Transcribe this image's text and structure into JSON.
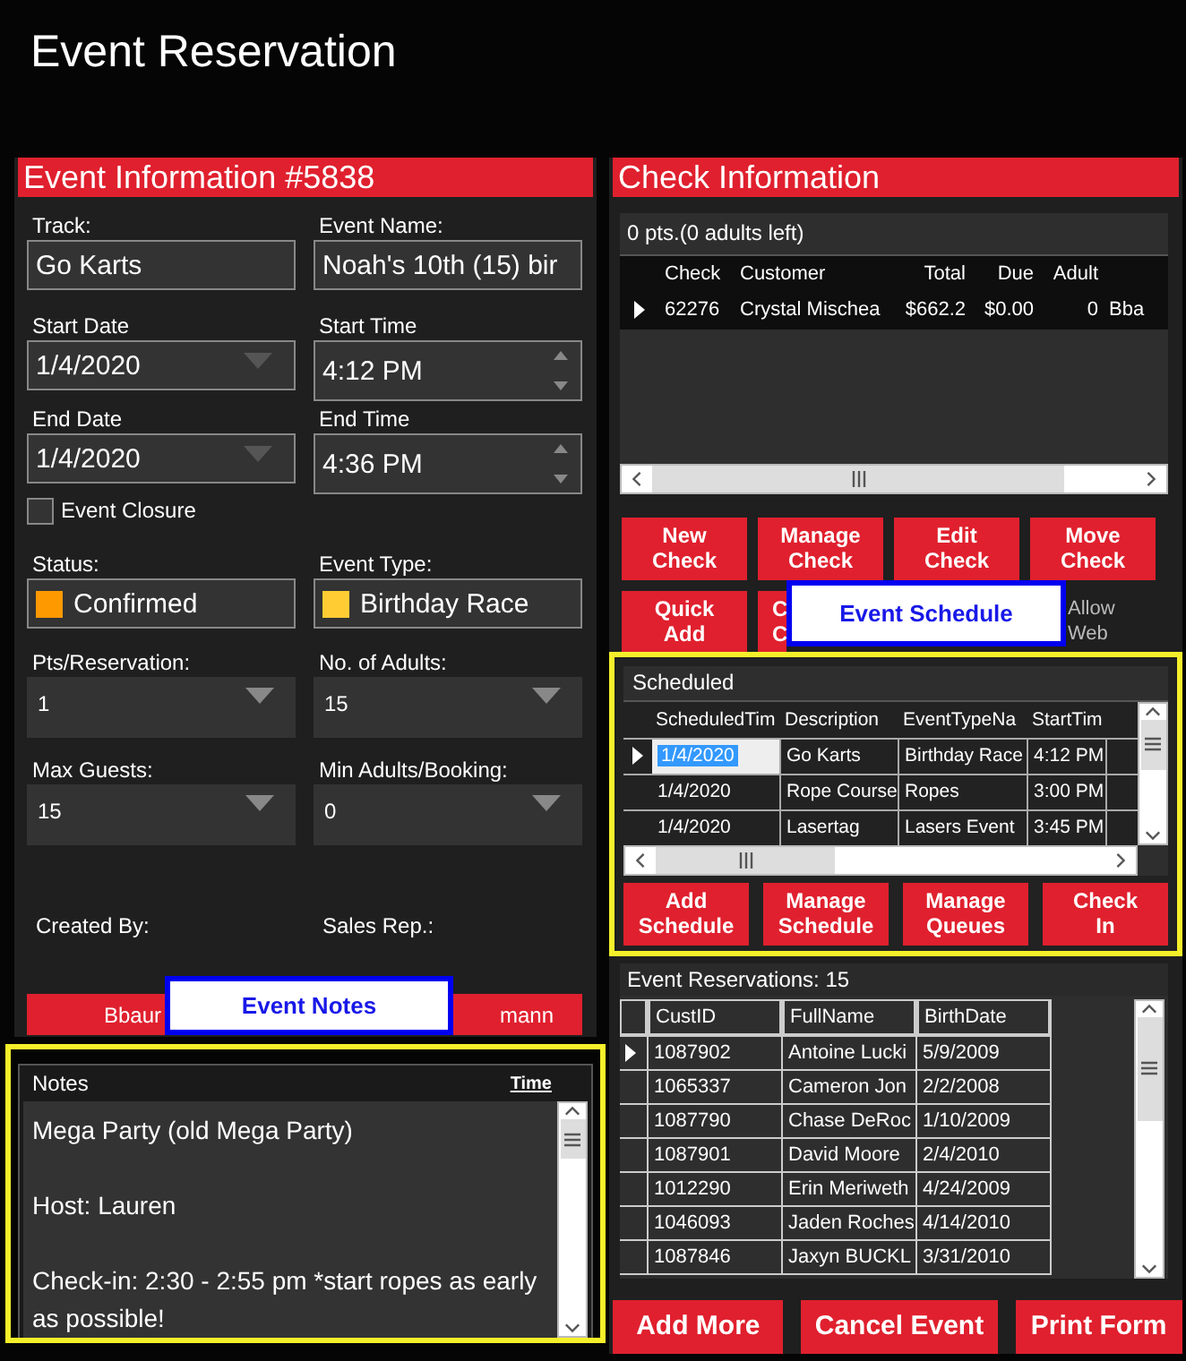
{
  "window": {
    "title": "Event Reservation"
  },
  "event_info": {
    "title": "Event Information #5838",
    "fields": [
      {
        "kind": "text",
        "label": "Track:",
        "value": "Go Karts"
      },
      {
        "kind": "text",
        "label": "Event Name:",
        "value": "Noah's 10th (15) bir"
      },
      {
        "kind": "date",
        "label": "Start Date",
        "value": "1/4/2020"
      },
      {
        "kind": "time",
        "label": "Start Time",
        "value": "4:12 PM"
      },
      {
        "kind": "date",
        "label": "End Date",
        "value": "1/4/2020"
      },
      {
        "kind": "time",
        "label": "End Time",
        "value": "4:36 PM"
      },
      {
        "kind": "checkbox",
        "label": "Event Closure",
        "checked": false
      },
      {
        "kind": "swatch",
        "label": "Status:",
        "value": "Confirmed",
        "color": "#ff9900"
      },
      {
        "kind": "swatch",
        "label": "Event Type:",
        "value": "Birthday Race",
        "color": "#ffcc33"
      },
      {
        "kind": "dropdown",
        "label": "Pts/Reservation:",
        "value": "1"
      },
      {
        "kind": "dropdown",
        "label": "No. of Adults:",
        "value": "15"
      },
      {
        "kind": "dropdown",
        "label": "Max Guests:",
        "value": "15"
      },
      {
        "kind": "dropdown",
        "label": "Min Adults/Booking:",
        "value": "0"
      }
    ],
    "created_by": {
      "label": "Created By:",
      "value": "Bbaur"
    },
    "sales_rep": {
      "label": "Sales Rep.:",
      "value": "mann"
    }
  },
  "notes": {
    "title": "Notes",
    "time_link": "Time",
    "paragraphs": [
      "Mega Party (old Mega Party)",
      "Host: Lauren",
      "Check-in: 2:30 - 2:55 pm *start ropes as early as possible!"
    ]
  },
  "check_info": {
    "title": "Check Information",
    "summary": "0 pts.(0 adults left)",
    "columns": [
      "Check",
      "Customer",
      "Total",
      "Due",
      "Adult"
    ],
    "rows": [
      {
        "selected": true,
        "cells": [
          "62276",
          "Crystal Mischea",
          "$662.2",
          "$0.00",
          "0",
          "Bba"
        ]
      }
    ],
    "buttons": [
      {
        "lines": [
          "New",
          "Check"
        ]
      },
      {
        "lines": [
          "Manage",
          "Check"
        ]
      },
      {
        "lines": [
          "Edit",
          "Check"
        ]
      },
      {
        "lines": [
          "Move",
          "Check"
        ]
      },
      {
        "lines": [
          "Quick",
          "Add"
        ]
      },
      {
        "lines": [
          "C",
          "C"
        ]
      }
    ],
    "allow_web": [
      "Allow",
      "Web"
    ]
  },
  "schedule": {
    "title": "Scheduled",
    "columns": [
      "ScheduledTim",
      "Description",
      "EventTypeNa",
      "StartTim"
    ],
    "rows": [
      {
        "selected": true,
        "cells": [
          "1/4/2020",
          "Go Karts",
          "Birthday Race",
          "4:12 PM"
        ]
      },
      {
        "selected": false,
        "cells": [
          "1/4/2020",
          "Rope Course",
          "Ropes",
          "3:00 PM"
        ]
      },
      {
        "selected": false,
        "cells": [
          "1/4/2020",
          "Lasertag",
          "Lasers Event",
          "3:45 PM"
        ]
      }
    ],
    "buttons": [
      {
        "lines": [
          "Add",
          "Schedule"
        ]
      },
      {
        "lines": [
          "Manage",
          "Schedule"
        ]
      },
      {
        "lines": [
          "Manage",
          "Queues"
        ]
      },
      {
        "lines": [
          "Check",
          "In"
        ]
      }
    ]
  },
  "reservations": {
    "title": "Event Reservations: 15",
    "columns": [
      "CustID",
      "FullName",
      "BirthDate"
    ],
    "rows": [
      {
        "selected": true,
        "cells": [
          "1087902",
          "Antoine Lucki",
          "5/9/2009"
        ]
      },
      {
        "selected": false,
        "cells": [
          "1065337",
          "Cameron Jon",
          "2/2/2008"
        ]
      },
      {
        "selected": false,
        "cells": [
          "1087790",
          "Chase DeRoc",
          "1/10/2009"
        ]
      },
      {
        "selected": false,
        "cells": [
          "1087901",
          "David Moore",
          "2/4/2010"
        ]
      },
      {
        "selected": false,
        "cells": [
          "1012290",
          "Erin Meriweth",
          "4/24/2009"
        ]
      },
      {
        "selected": false,
        "cells": [
          "1046093",
          "Jaden Roches",
          "4/14/2010"
        ]
      },
      {
        "selected": false,
        "cells": [
          "1087846",
          "Jaxyn  BUCKL",
          "3/31/2010"
        ]
      }
    ]
  },
  "footer_buttons": [
    "Add More",
    "Cancel Event",
    "Print Form"
  ],
  "callouts": [
    {
      "label": "Event Notes"
    },
    {
      "label": "Event Schedule"
    }
  ]
}
